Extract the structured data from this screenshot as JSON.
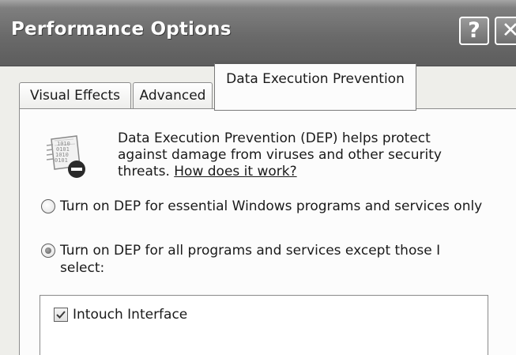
{
  "window": {
    "title": "Performance Options",
    "help_glyph": "?",
    "close_glyph": "✕",
    "icons": {
      "help": "help-icon",
      "close": "close-icon"
    }
  },
  "tabs": [
    {
      "label": "Visual Effects",
      "selected": false
    },
    {
      "label": "Advanced",
      "selected": false
    },
    {
      "label": "Data Execution Prevention",
      "selected": true
    }
  ],
  "dep": {
    "icon": "dep-shield-binary-icon",
    "intro_text": "Data Execution Prevention (DEP) helps protect against damage from viruses and other security threats.",
    "link_text": "How does it work?",
    "options": [
      {
        "label": "Turn on DEP for essential Windows programs and services only",
        "selected": false
      },
      {
        "label": "Turn on DEP for all programs and services except those I select:",
        "selected": true
      }
    ],
    "exceptions": [
      {
        "label": "Intouch Interface",
        "checked": true
      }
    ]
  },
  "colors": {
    "titlebar": "#6a6a6a",
    "panel": "#fcfcfc",
    "window": "#eeeeea"
  }
}
